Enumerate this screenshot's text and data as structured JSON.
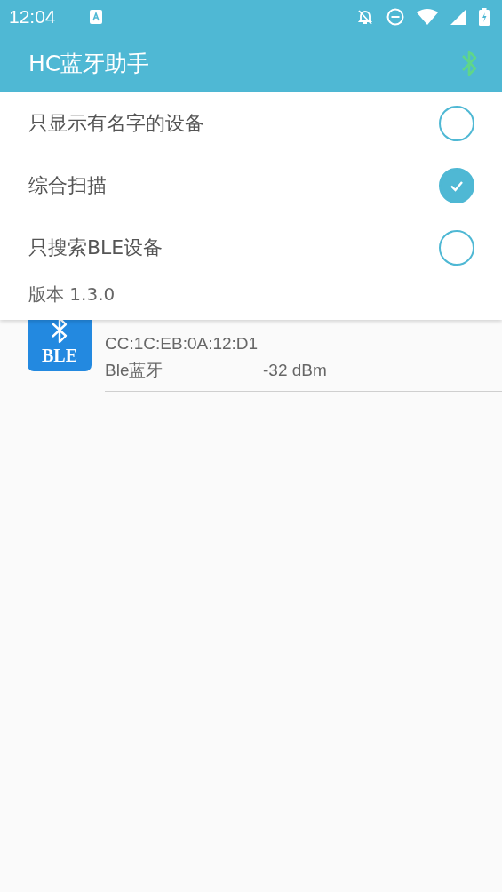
{
  "status_bar": {
    "time": "12:04"
  },
  "toolbar": {
    "title": "HC蓝牙助手"
  },
  "filter_menu": {
    "options": [
      {
        "label": "只显示有名字的设备",
        "checked": false
      },
      {
        "label": "综合扫描",
        "checked": true
      },
      {
        "label": "只搜索BLE设备",
        "checked": false
      }
    ],
    "version": "版本 1.3.0"
  },
  "devices": [
    {
      "badge": "BLE",
      "address": "CC:1C:EB:0A:12:D1",
      "type": "Ble蓝牙",
      "signal": "-32 dBm"
    }
  ]
}
